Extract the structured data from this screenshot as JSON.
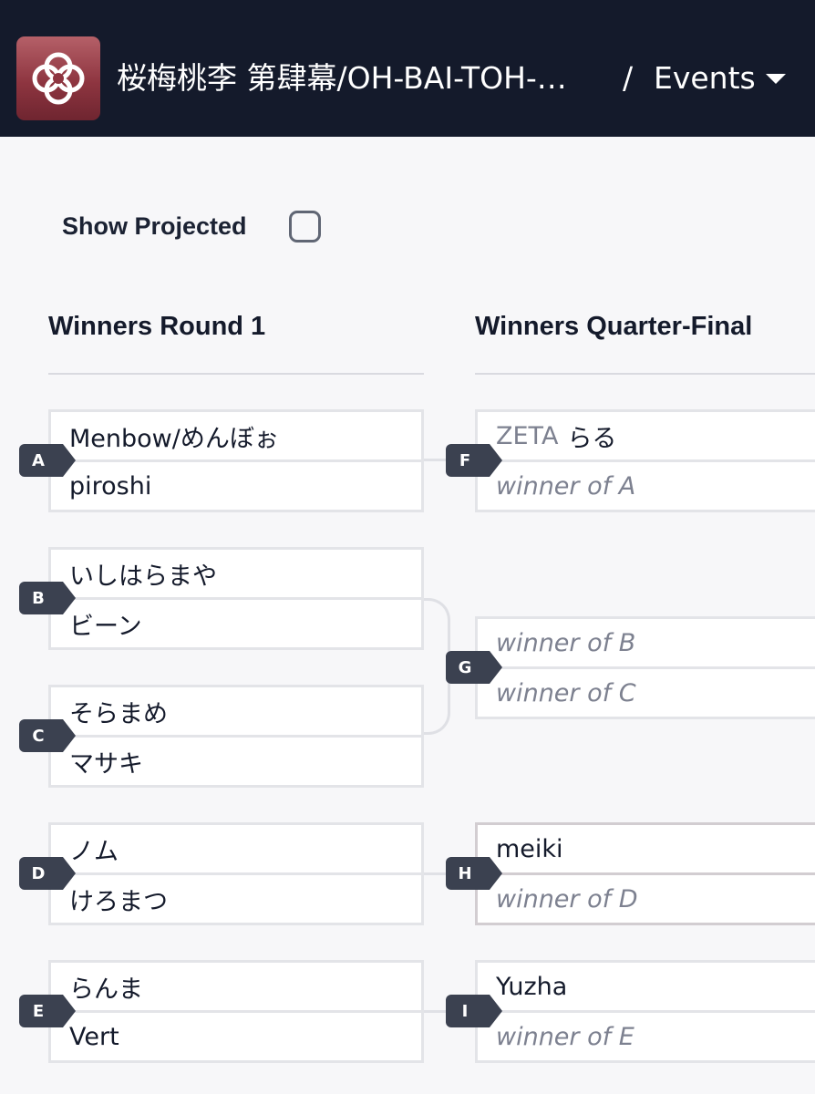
{
  "header": {
    "title": "桜梅桃李 第肆幕/OH-BAI-TOH-…",
    "separator": "/",
    "section": "Events",
    "icons": {
      "logo": "knot-logo-icon",
      "dropdown": "chevron-down-icon"
    },
    "colors": {
      "bar": "#141a2b",
      "logo_bg": "#8e3540"
    }
  },
  "controls": {
    "show_projected_label": "Show Projected",
    "show_projected_checked": false
  },
  "rounds": [
    {
      "title": "Winners Round 1"
    },
    {
      "title": "Winners Quarter-Final"
    }
  ],
  "matches": {
    "A": {
      "id": "A",
      "p1": "Menbow/めんぼぉ",
      "p2": "piroshi"
    },
    "B": {
      "id": "B",
      "p1": "いしはらまや",
      "p2": "ビーン"
    },
    "C": {
      "id": "C",
      "p1": "そらまめ",
      "p2": "マサキ"
    },
    "D": {
      "id": "D",
      "p1": "ノム",
      "p2": "けろまつ"
    },
    "E": {
      "id": "E",
      "p1": "らんま",
      "p2": "Vert"
    },
    "F": {
      "id": "F",
      "p1_team": "ZETA",
      "p1": "らる",
      "p2": "winner of A"
    },
    "G": {
      "id": "G",
      "p1": "winner of B",
      "p2": "winner of C"
    },
    "H": {
      "id": "H",
      "p1": "meiki",
      "p2": "winner of D"
    },
    "I": {
      "id": "I",
      "p1": "Yuzha",
      "p2": "winner of E"
    }
  }
}
